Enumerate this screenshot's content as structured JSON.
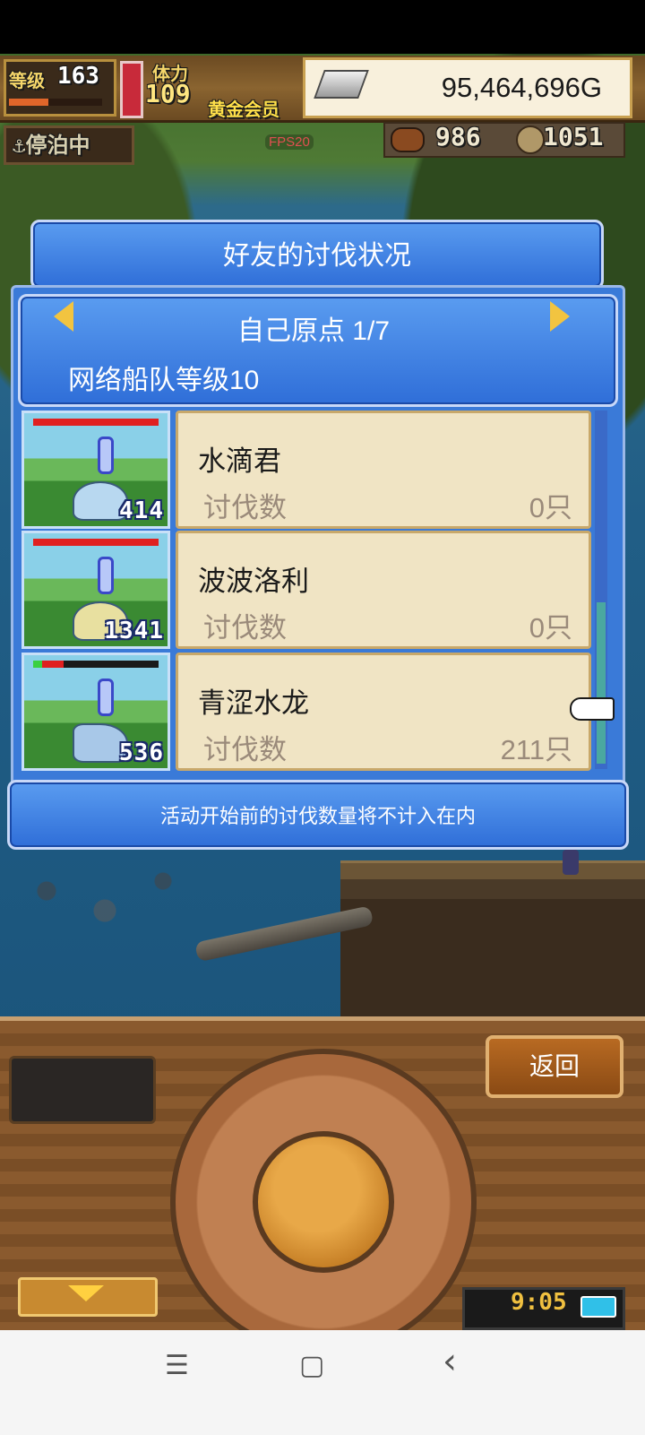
{
  "hud": {
    "level_label": "等级",
    "level_value": "163",
    "stamina_label": "体力",
    "stamina_value": "109",
    "membership": "黄金会员",
    "gold_value": "95,464,696G",
    "gold_icon": "silver-bar-icon",
    "dock_status": "停泊中",
    "fps": "FPS20",
    "food_value": "986",
    "coin_value": "1051"
  },
  "dialog": {
    "title": "好友的讨伐状况",
    "region": "自己原点 1/7",
    "fleet_level": "网络船队等级10",
    "entries": [
      {
        "name": "水滴君",
        "label": "讨伐数",
        "count": "0只",
        "thumb_number": "414"
      },
      {
        "name": "波波洛利",
        "label": "讨伐数",
        "count": "0只",
        "thumb_number": "1341"
      },
      {
        "name": "青涩水龙",
        "label": "讨伐数",
        "count": "211只",
        "thumb_number": "536"
      }
    ],
    "note": "活动开始前的讨伐数量将不计入在内"
  },
  "controls": {
    "back_label": "返回",
    "clock": "9:05"
  },
  "navbar": {
    "menu_glyph": "☰",
    "home_glyph": "▢",
    "back_glyph": "‹"
  },
  "colors": {
    "panel_blue": "#3a7ad8",
    "card_bg": "#f0e4c4",
    "arrow_gold": "#f2c440",
    "wood": "#8a5a2e"
  }
}
